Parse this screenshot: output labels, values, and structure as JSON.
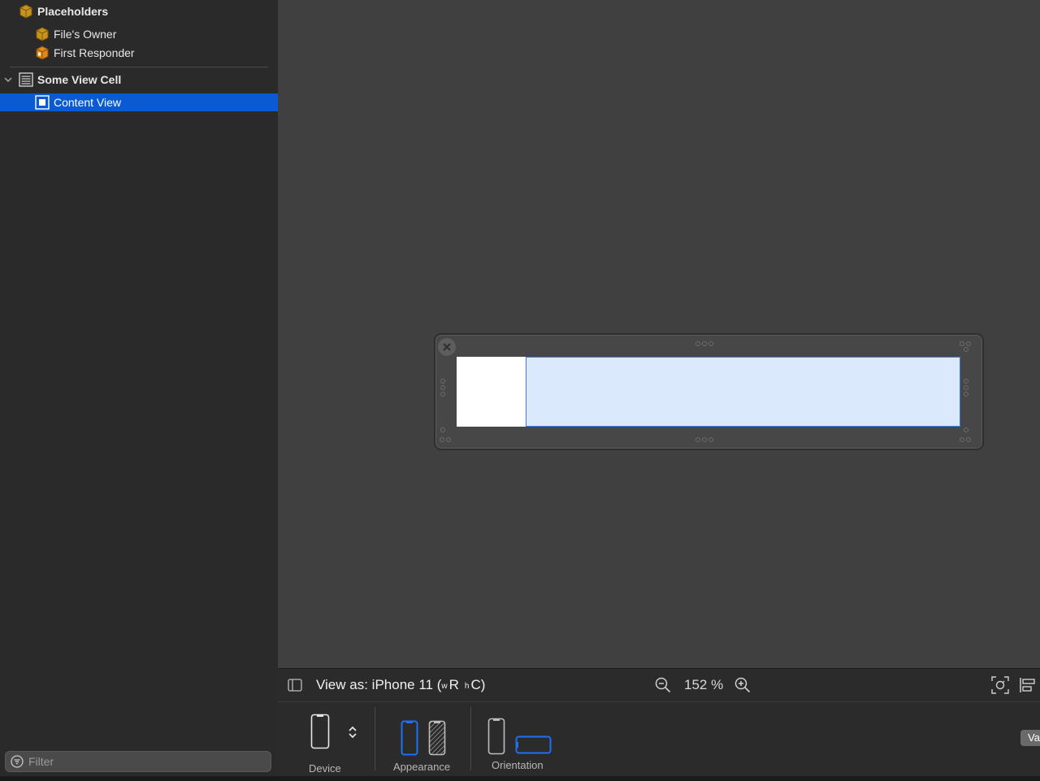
{
  "outline": {
    "placeholders_label": "Placeholders",
    "files_owner_label": "File's Owner",
    "first_responder_label": "First Responder",
    "view_cell_label": "Some View Cell",
    "content_view_label": "Content View"
  },
  "filter": {
    "placeholder": "Filter"
  },
  "toolbar": {
    "view_as_prefix": "View as: iPhone 11 (",
    "size_w_small": "w",
    "size_w": "R",
    "size_h_small": "h",
    "size_h": "C",
    "view_as_suffix": ")",
    "zoom_level": "152 %"
  },
  "config": {
    "device_label": "Device",
    "appearance_label": "Appearance",
    "orientation_label": "Orientation",
    "va_button": "Va"
  },
  "colors": {
    "selection": "#0a5ad4",
    "accent_blue": "#1e6ff2",
    "placeholder_icon": "#d9a520",
    "first_responder_icon": "#e98a1a"
  }
}
